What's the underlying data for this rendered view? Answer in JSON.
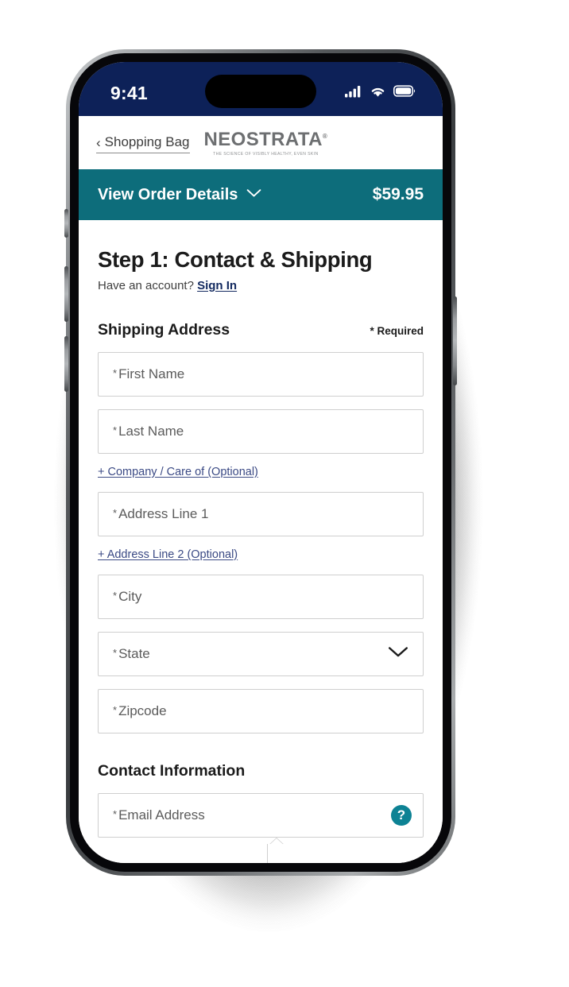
{
  "status_bar": {
    "time": "9:41",
    "icons": [
      "cellular-signal-icon",
      "wifi-icon",
      "battery-icon"
    ]
  },
  "nav": {
    "back_label": "Shopping Bag",
    "back_icon": "chevron-left-icon",
    "brand": "NEOSTRATA",
    "brand_trademark": "®",
    "brand_tagline": "THE SCIENCE OF VISIBLY HEALTHY, EVEN SKIN"
  },
  "order_bar": {
    "label": "View Order Details",
    "chevron_icon": "chevron-down-icon",
    "total": "$59.95"
  },
  "main": {
    "step_title": "Step 1: Contact & Shipping",
    "account_prompt": "Have an account?",
    "signin_label": "Sign In",
    "shipping_section_title": "Shipping Address",
    "required_note": "* Required",
    "fields": [
      {
        "name": "first-name",
        "placeholder": "First Name",
        "required": true,
        "value": ""
      },
      {
        "name": "last-name",
        "placeholder": "Last Name",
        "required": true,
        "value": ""
      },
      {
        "name": "address-line-1",
        "placeholder": "Address Line 1",
        "required": true,
        "value": ""
      },
      {
        "name": "city",
        "placeholder": "City",
        "required": true,
        "value": ""
      },
      {
        "name": "state",
        "placeholder": "State",
        "required": true,
        "value": ""
      },
      {
        "name": "zipcode",
        "placeholder": "Zipcode",
        "required": true,
        "value": ""
      }
    ],
    "company_optional_link": "+ Company / Care of (Optional)",
    "address2_optional_link": "+ Address Line 2 (Optional)",
    "state_chevron_icon": "chevron-down-icon",
    "contact_section_title": "Contact Information",
    "email_placeholder": "Email Address",
    "email_value": "",
    "email_help_icon": "question-mark-help-icon",
    "required_marker": "*"
  },
  "colors": {
    "status_bar_navy": "#0d2158",
    "order_bar_teal": "#0d6d7b",
    "help_badge_teal": "#0d8294",
    "link_blue": "#3b4a85",
    "signin_navy": "#12295f",
    "field_border": "#cfcfcf",
    "text_dark": "#1b1b1b"
  }
}
